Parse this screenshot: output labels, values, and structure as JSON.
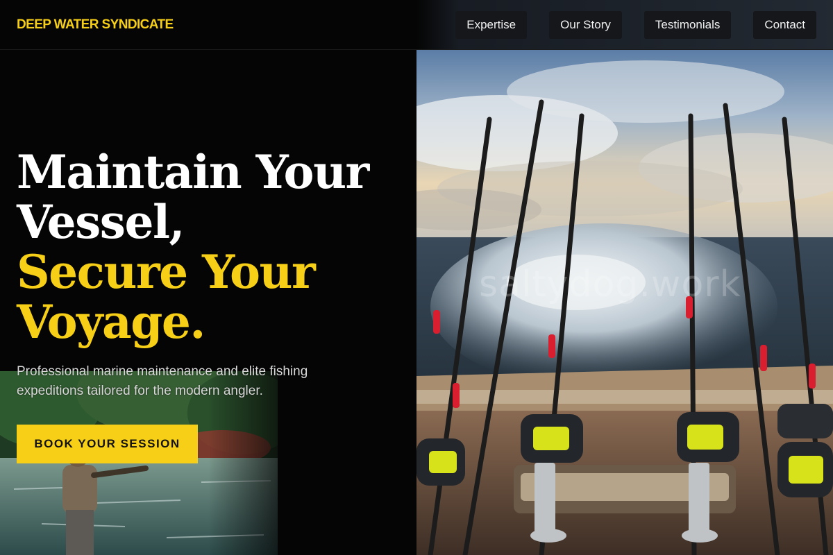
{
  "header": {
    "brand": "DEEP WATER SYNDICATE",
    "nav": [
      "Expertise",
      "Our Story",
      "Testimonials",
      "Contact"
    ]
  },
  "hero": {
    "headline_white_1": "Maintain Your",
    "headline_white_2": "Vessel,",
    "headline_gold_1": "Secure Your",
    "headline_gold_2": "Voyage.",
    "subtext": "Professional marine maintenance and elite fishing expeditions tailored for the modern angler.",
    "cta_label": "BOOK YOUR SESSION"
  },
  "watermark": "saltydog.work",
  "colors": {
    "accent": "#f7cf16",
    "background": "#050505",
    "nav_button": "#15171a"
  }
}
